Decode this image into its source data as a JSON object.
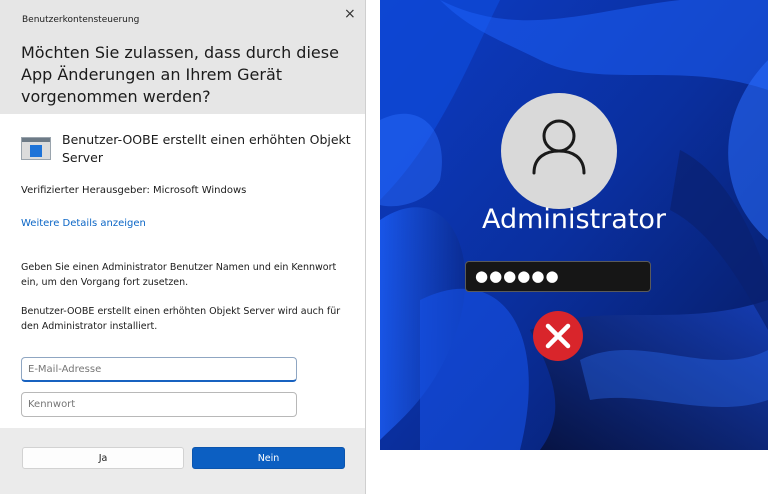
{
  "uac": {
    "title": "Benutzerkontensteuerung",
    "close_glyph": "×",
    "question": "Möchten Sie zulassen, dass durch diese App Änderungen an Ihrem Gerät vorgenommen werden?",
    "app_name": "Benutzer-OOBE erstellt einen erhöhten Objekt Server",
    "publisher": "Verifizierter Herausgeber: Microsoft Windows",
    "details_link": "Weitere Details anzeigen",
    "instruction_1": "Geben Sie einen Administrator Benutzer Namen und ein Kennwort ein, um den Vorgang fort zusetzen.",
    "instruction_2": "Benutzer-OOBE erstellt einen erhöhten Objekt Server wird auch für den Administrator installiert.",
    "email_placeholder": "E-Mail-Adresse",
    "email_value": "",
    "password_placeholder": "Kennwort",
    "password_value": "",
    "yes_label": "Ja",
    "no_label": "Nein",
    "accent_color": "#0c5fc2"
  },
  "lock": {
    "username": "Administrator",
    "password_mask": "●●●●●●",
    "avatar_icon": "user-icon",
    "error_icon": "error-x-icon",
    "error_color": "#d9252b"
  }
}
